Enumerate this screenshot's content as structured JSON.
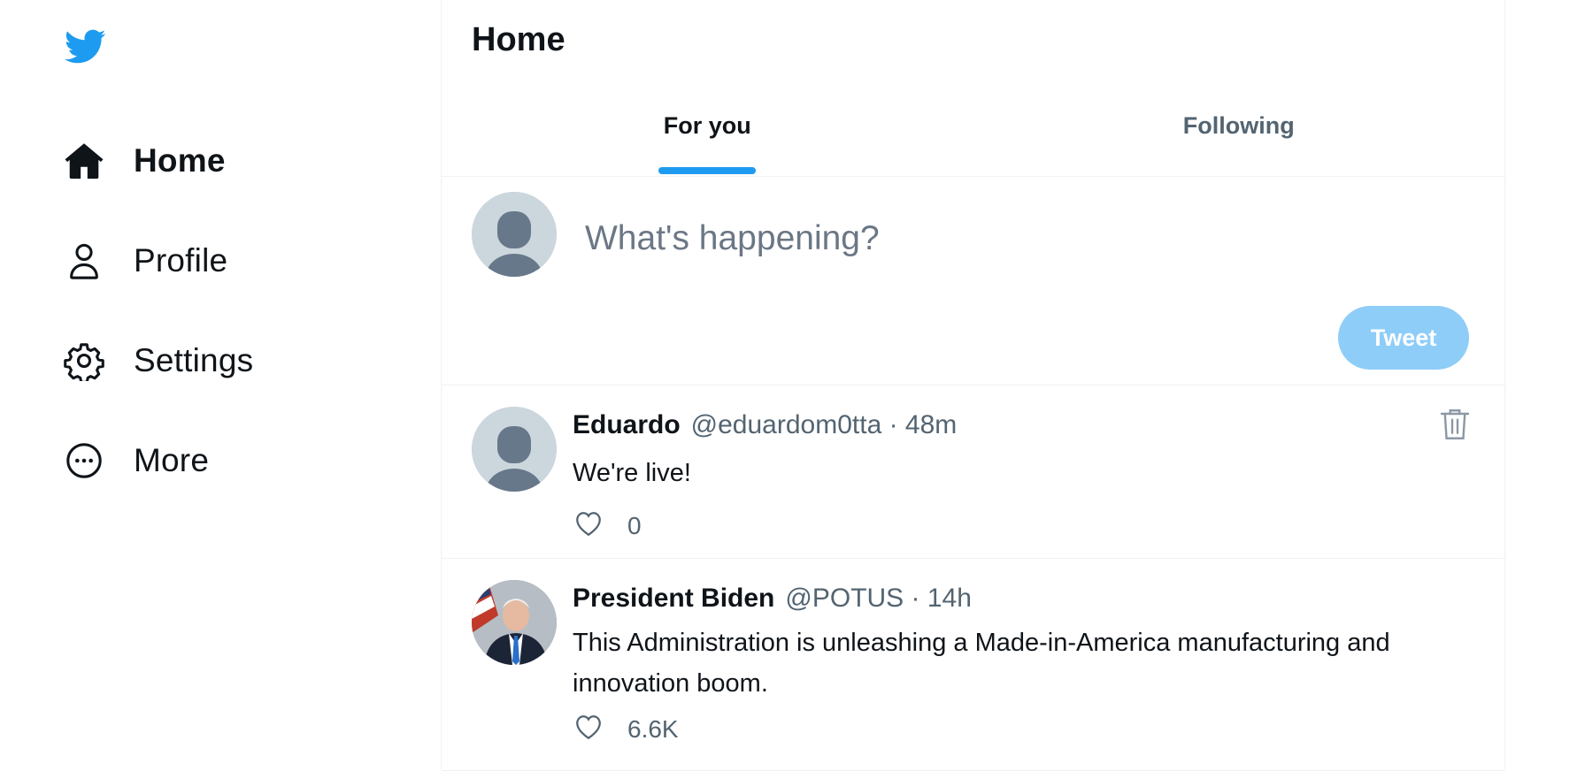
{
  "sidebar": {
    "logo_icon": "twitter-bird-icon",
    "items": [
      {
        "label": "Home",
        "icon": "home-icon",
        "active": true
      },
      {
        "label": "Profile",
        "icon": "profile-icon",
        "active": false
      },
      {
        "label": "Settings",
        "icon": "gear-icon",
        "active": false
      },
      {
        "label": "More",
        "icon": "more-circle-icon",
        "active": false
      }
    ]
  },
  "header": {
    "title": "Home"
  },
  "tabs": [
    {
      "label": "For you",
      "active": true
    },
    {
      "label": "Following",
      "active": false
    }
  ],
  "composer": {
    "placeholder": "What's happening?",
    "value": "",
    "tweet_label": "Tweet"
  },
  "feed": [
    {
      "name": "Eduardo",
      "meta": "@eduardom0tta · 48m",
      "text": "We're live!",
      "likes": "0",
      "deletable": true
    },
    {
      "name": "President Biden",
      "meta": "@POTUS · 14h",
      "text": "This Administration is unleashing a Made-in-America manufacturing and innovation boom.",
      "likes": "6.6K",
      "deletable": false
    }
  ],
  "colors": {
    "accent": "#1d9bf0",
    "tweet_button_disabled": "#8ecdf8",
    "muted_text": "#536471",
    "border": "#eff3f4"
  }
}
